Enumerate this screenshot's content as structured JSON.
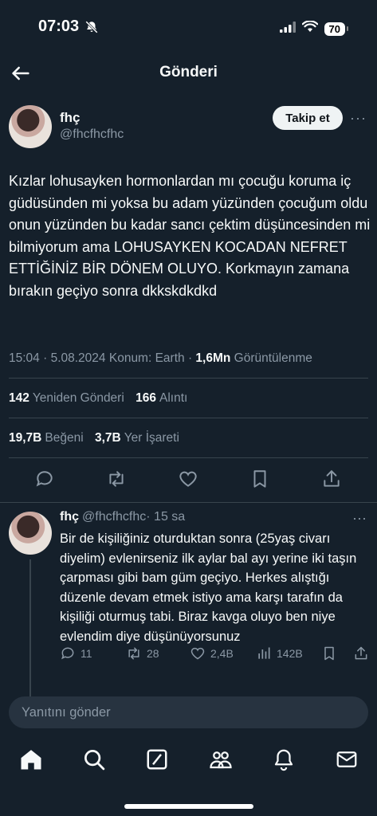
{
  "status_bar": {
    "time": "07:03",
    "battery": "70"
  },
  "header": {
    "title": "Gönderi"
  },
  "tweet": {
    "author_name": "fhç",
    "author_handle": "@fhcfhcfhc",
    "follow_label": "Takip et",
    "more_label": "···",
    "text": "Kızlar lohusayken hormonlardan mı çocuğu koruma iç güdüsünden mi yoksa bu adam yüzünden çocuğum oldu onun yüzünden bu kadar sancı çektim düşüncesinden mi bilmiyorum ama LOHUSAYKEN KOCADAN NEFRET ETTİĞİNİZ BİR DÖNEM OLUYO. Korkmayın zamana bırakın geçiyo sonra dkkskdkdkd",
    "time": "15:04",
    "date": "5.08.2024",
    "location": "Konum: Earth",
    "views_count": "1,6Mn",
    "views_label": "Görüntülenme",
    "retweets_count": "142",
    "retweets_label": "Yeniden Gönderi",
    "quotes_count": "166",
    "quotes_label": "Alıntı",
    "likes_count": "19,7B",
    "likes_label": "Beğeni",
    "bookmarks_count": "3,7B",
    "bookmarks_label": "Yer İşareti"
  },
  "reply": {
    "author_name": "fhç",
    "author_handle": "@fhcfhcfhc",
    "age": "· 15 sa",
    "more_label": "···",
    "text": "Bir de kişiliğiniz oturduktan sonra (25yaş civarı diyelim) evlenirseniz ilk aylar bal ayı yerine iki taşın çarpması gibi bam güm geçiyo. Herkes alıştığı düzenle devam etmek istiyo ama karşı tarafın da kişiliği oturmuş tabi. Biraz kavga oluyo ben niye evlendim diye düşünüyorsunuz",
    "replies": "11",
    "retweets": "28",
    "likes": "2,4B",
    "views": "142B"
  },
  "composer": {
    "placeholder": "Yanıtını gönder"
  },
  "colors": {
    "background": "#15202b",
    "secondary_text": "#8b98a5",
    "divider": "#38444d"
  }
}
